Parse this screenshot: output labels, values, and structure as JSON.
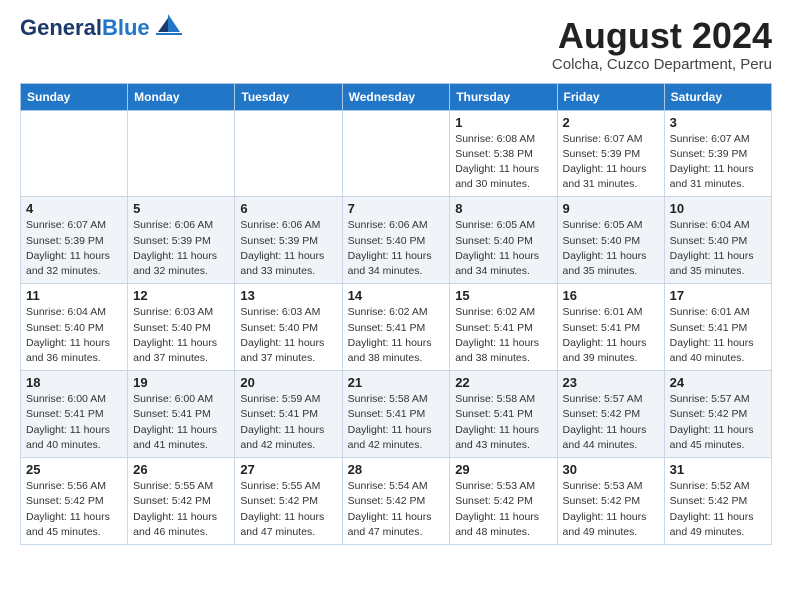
{
  "logo": {
    "text_general": "General",
    "text_blue": "Blue"
  },
  "title": "August 2024",
  "subtitle": "Colcha, Cuzco Department, Peru",
  "days_of_week": [
    "Sunday",
    "Monday",
    "Tuesday",
    "Wednesday",
    "Thursday",
    "Friday",
    "Saturday"
  ],
  "weeks": [
    [
      {
        "day": "",
        "info": ""
      },
      {
        "day": "",
        "info": ""
      },
      {
        "day": "",
        "info": ""
      },
      {
        "day": "",
        "info": ""
      },
      {
        "day": "1",
        "info": "Sunrise: 6:08 AM\nSunset: 5:38 PM\nDaylight: 11 hours\nand 30 minutes."
      },
      {
        "day": "2",
        "info": "Sunrise: 6:07 AM\nSunset: 5:39 PM\nDaylight: 11 hours\nand 31 minutes."
      },
      {
        "day": "3",
        "info": "Sunrise: 6:07 AM\nSunset: 5:39 PM\nDaylight: 11 hours\nand 31 minutes."
      }
    ],
    [
      {
        "day": "4",
        "info": "Sunrise: 6:07 AM\nSunset: 5:39 PM\nDaylight: 11 hours\nand 32 minutes."
      },
      {
        "day": "5",
        "info": "Sunrise: 6:06 AM\nSunset: 5:39 PM\nDaylight: 11 hours\nand 32 minutes."
      },
      {
        "day": "6",
        "info": "Sunrise: 6:06 AM\nSunset: 5:39 PM\nDaylight: 11 hours\nand 33 minutes."
      },
      {
        "day": "7",
        "info": "Sunrise: 6:06 AM\nSunset: 5:40 PM\nDaylight: 11 hours\nand 34 minutes."
      },
      {
        "day": "8",
        "info": "Sunrise: 6:05 AM\nSunset: 5:40 PM\nDaylight: 11 hours\nand 34 minutes."
      },
      {
        "day": "9",
        "info": "Sunrise: 6:05 AM\nSunset: 5:40 PM\nDaylight: 11 hours\nand 35 minutes."
      },
      {
        "day": "10",
        "info": "Sunrise: 6:04 AM\nSunset: 5:40 PM\nDaylight: 11 hours\nand 35 minutes."
      }
    ],
    [
      {
        "day": "11",
        "info": "Sunrise: 6:04 AM\nSunset: 5:40 PM\nDaylight: 11 hours\nand 36 minutes."
      },
      {
        "day": "12",
        "info": "Sunrise: 6:03 AM\nSunset: 5:40 PM\nDaylight: 11 hours\nand 37 minutes."
      },
      {
        "day": "13",
        "info": "Sunrise: 6:03 AM\nSunset: 5:40 PM\nDaylight: 11 hours\nand 37 minutes."
      },
      {
        "day": "14",
        "info": "Sunrise: 6:02 AM\nSunset: 5:41 PM\nDaylight: 11 hours\nand 38 minutes."
      },
      {
        "day": "15",
        "info": "Sunrise: 6:02 AM\nSunset: 5:41 PM\nDaylight: 11 hours\nand 38 minutes."
      },
      {
        "day": "16",
        "info": "Sunrise: 6:01 AM\nSunset: 5:41 PM\nDaylight: 11 hours\nand 39 minutes."
      },
      {
        "day": "17",
        "info": "Sunrise: 6:01 AM\nSunset: 5:41 PM\nDaylight: 11 hours\nand 40 minutes."
      }
    ],
    [
      {
        "day": "18",
        "info": "Sunrise: 6:00 AM\nSunset: 5:41 PM\nDaylight: 11 hours\nand 40 minutes."
      },
      {
        "day": "19",
        "info": "Sunrise: 6:00 AM\nSunset: 5:41 PM\nDaylight: 11 hours\nand 41 minutes."
      },
      {
        "day": "20",
        "info": "Sunrise: 5:59 AM\nSunset: 5:41 PM\nDaylight: 11 hours\nand 42 minutes."
      },
      {
        "day": "21",
        "info": "Sunrise: 5:58 AM\nSunset: 5:41 PM\nDaylight: 11 hours\nand 42 minutes."
      },
      {
        "day": "22",
        "info": "Sunrise: 5:58 AM\nSunset: 5:41 PM\nDaylight: 11 hours\nand 43 minutes."
      },
      {
        "day": "23",
        "info": "Sunrise: 5:57 AM\nSunset: 5:42 PM\nDaylight: 11 hours\nand 44 minutes."
      },
      {
        "day": "24",
        "info": "Sunrise: 5:57 AM\nSunset: 5:42 PM\nDaylight: 11 hours\nand 45 minutes."
      }
    ],
    [
      {
        "day": "25",
        "info": "Sunrise: 5:56 AM\nSunset: 5:42 PM\nDaylight: 11 hours\nand 45 minutes."
      },
      {
        "day": "26",
        "info": "Sunrise: 5:55 AM\nSunset: 5:42 PM\nDaylight: 11 hours\nand 46 minutes."
      },
      {
        "day": "27",
        "info": "Sunrise: 5:55 AM\nSunset: 5:42 PM\nDaylight: 11 hours\nand 47 minutes."
      },
      {
        "day": "28",
        "info": "Sunrise: 5:54 AM\nSunset: 5:42 PM\nDaylight: 11 hours\nand 47 minutes."
      },
      {
        "day": "29",
        "info": "Sunrise: 5:53 AM\nSunset: 5:42 PM\nDaylight: 11 hours\nand 48 minutes."
      },
      {
        "day": "30",
        "info": "Sunrise: 5:53 AM\nSunset: 5:42 PM\nDaylight: 11 hours\nand 49 minutes."
      },
      {
        "day": "31",
        "info": "Sunrise: 5:52 AM\nSunset: 5:42 PM\nDaylight: 11 hours\nand 49 minutes."
      }
    ]
  ]
}
